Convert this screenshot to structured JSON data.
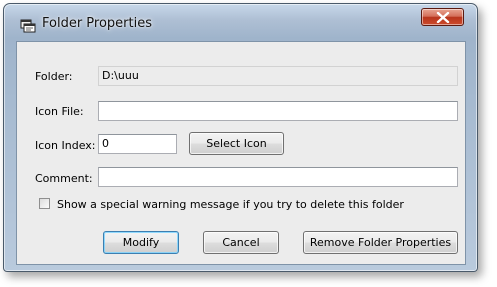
{
  "window": {
    "title": "Folder Properties",
    "app_icon": "folder-properties-icon",
    "close_icon": "close-icon"
  },
  "form": {
    "folder_label": "Folder:",
    "folder_value": "D:\\uuu",
    "icon_file_label": "Icon File:",
    "icon_file_value": "",
    "icon_index_label": "Icon Index:",
    "icon_index_value": "0",
    "select_icon_label": "Select Icon",
    "comment_label": "Comment:",
    "comment_value": "",
    "warning_checkbox_label": "Show a special warning message if you try to delete this folder",
    "warning_checkbox_checked": false
  },
  "buttons": {
    "modify": "Modify",
    "cancel": "Cancel",
    "remove": "Remove Folder Properties"
  },
  "colors": {
    "close_button": "#c8452b",
    "client_background": "#ececec",
    "default_button_border": "#3c7fb1"
  }
}
